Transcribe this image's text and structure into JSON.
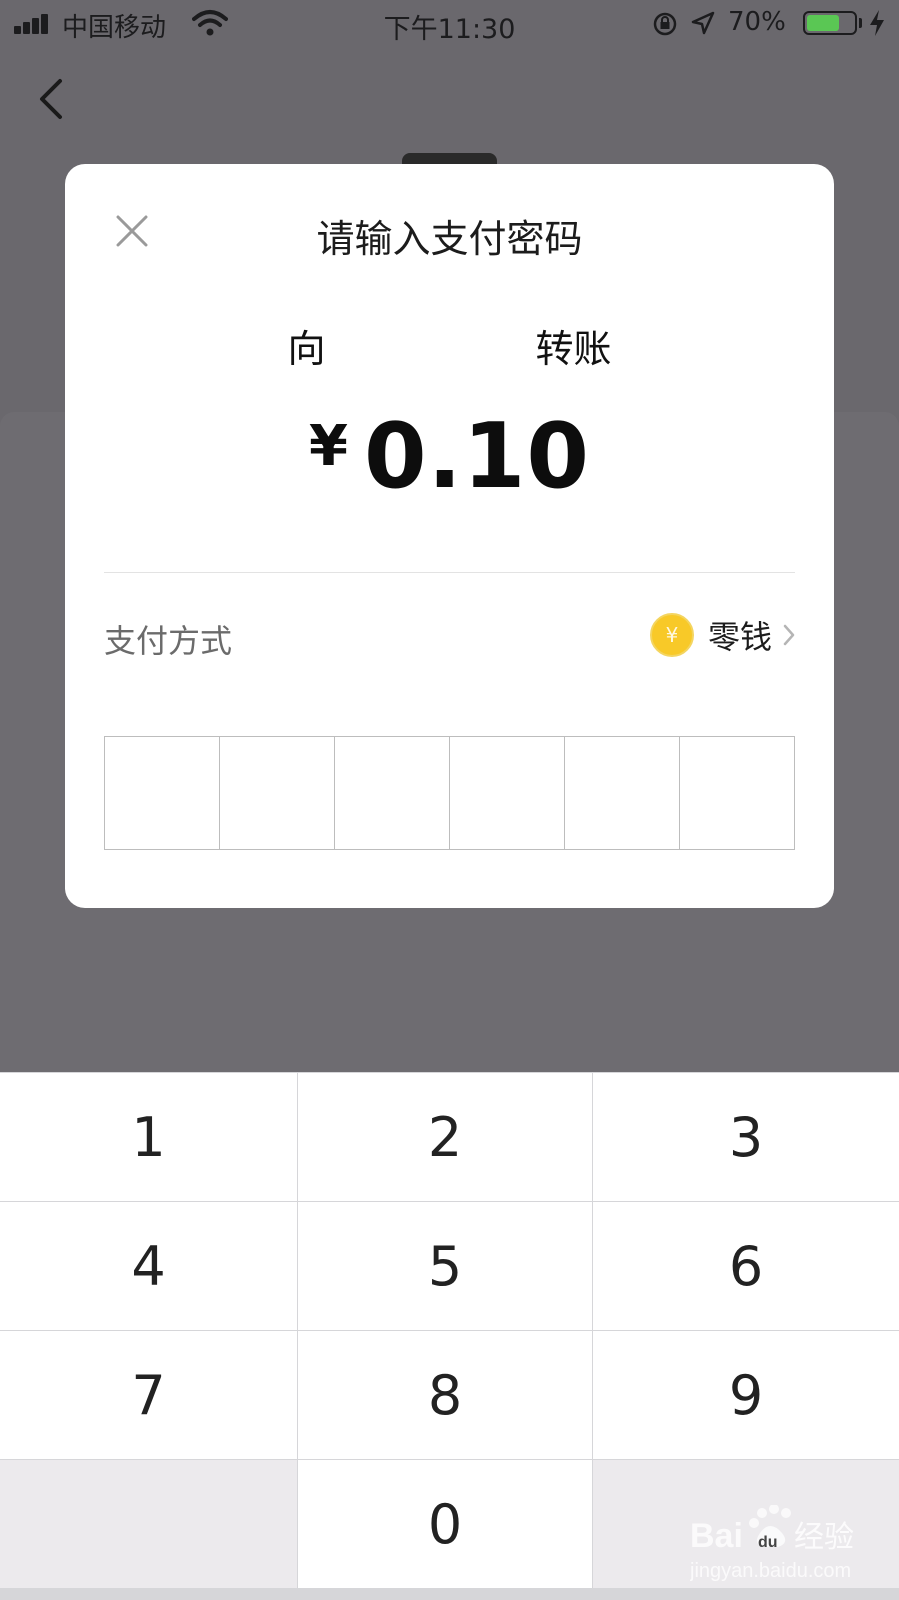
{
  "status_bar": {
    "carrier": "中国移动",
    "time": "下午11:30",
    "battery_percent": "70%",
    "battery_level": 0.7,
    "battery_color": "#5ac754"
  },
  "nav": {
    "back_icon": "chevron-left-icon"
  },
  "dialog": {
    "close_icon": "close-icon",
    "title": "请输入支付密码",
    "payee_prefix": "向",
    "payee_suffix": "转账",
    "currency_symbol": "¥",
    "amount": "0.10",
    "pay_method_label": "支付方式",
    "pay_method_value": "零钱",
    "coin_icon_symbol": "¥",
    "coin_color": "#f8c928",
    "pin_length": 6
  },
  "keypad": {
    "keys": [
      "1",
      "2",
      "3",
      "4",
      "5",
      "6",
      "7",
      "8",
      "9",
      "",
      "0",
      ""
    ]
  },
  "watermark": {
    "text": "Baidu经验",
    "url": "jingyan.baidu.com"
  }
}
